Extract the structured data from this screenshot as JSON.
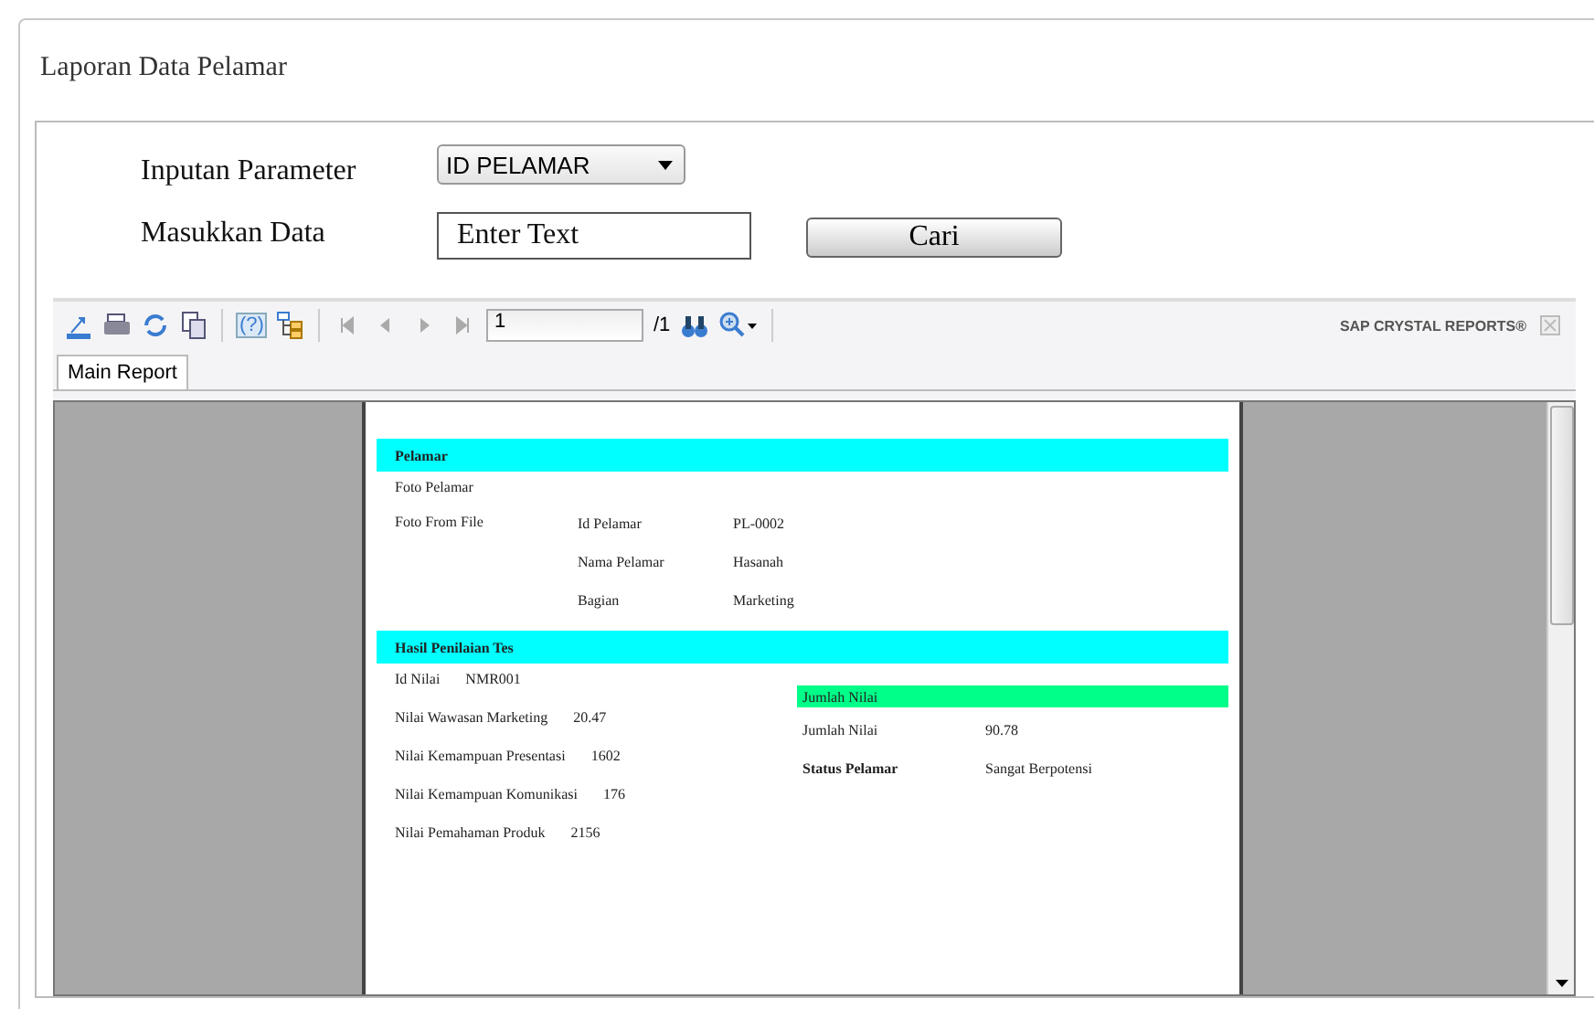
{
  "window": {
    "title": "Laporan Data Pelamar"
  },
  "form": {
    "parameter_label": "Inputan Parameter",
    "parameter_value": "ID PELAMAR",
    "data_label": "Masukkan Data",
    "data_placeholder": "Enter Text",
    "search_button": "Cari"
  },
  "viewer": {
    "toolbar": {
      "help": "(?)",
      "page": "1",
      "page_total": "/1",
      "brand": "SAP CRYSTAL REPORTS®"
    },
    "tabs": [
      {
        "label": "Main Report",
        "selected": true
      }
    ],
    "report": {
      "sections": [
        {
          "title": "Pelamar",
          "left": [
            {
              "label": "Foto Pelamar"
            },
            {
              "label": "Foto From File"
            }
          ],
          "fields": [
            {
              "label": "Id Pelamar",
              "value": "PL-0002"
            },
            {
              "label": "Nama Pelamar",
              "value": "Hasanah"
            },
            {
              "label": "Bagian",
              "value": "Marketing"
            }
          ]
        },
        {
          "title": "Hasil Penilaian Tes",
          "scores": [
            {
              "label": "Id Nilai",
              "value": "NMR001"
            },
            {
              "label": "Nilai Wawasan Marketing",
              "value": "20.47"
            },
            {
              "label": "Nilai Kemampuan Presentasi",
              "value": "1602"
            },
            {
              "label": "Nilai Kemampuan Komunikasi",
              "value": "176"
            },
            {
              "label": "Nilai Pemahaman Produk",
              "value": "2156"
            }
          ],
          "summary_title": "Jumlah Nilai",
          "summary": [
            {
              "label": "Jumlah Nilai",
              "value": "90.78",
              "bold": false
            },
            {
              "label": "Status Pelamar",
              "value": "Sangat Berpotensi",
              "bold": true
            }
          ]
        }
      ]
    }
  }
}
